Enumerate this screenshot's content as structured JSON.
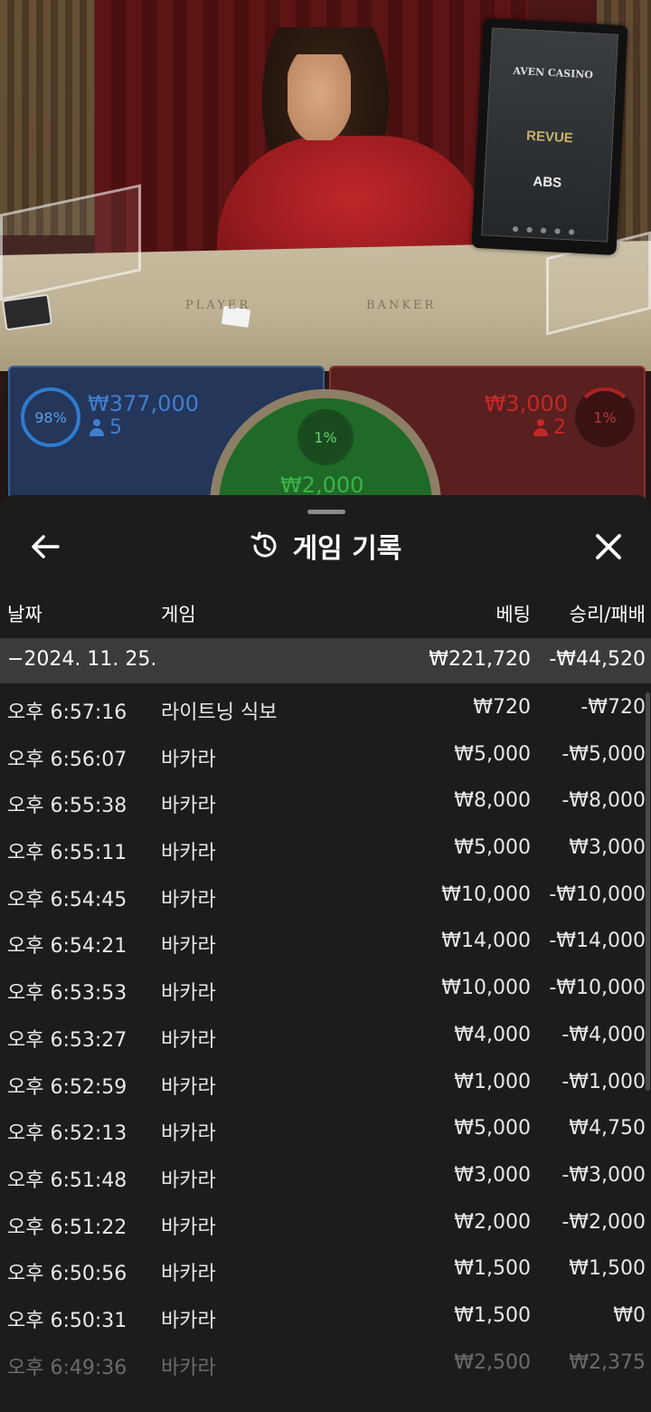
{
  "scene": {
    "table_labels": {
      "player": "PLAYER",
      "banker": "BANKER"
    },
    "monitor_brands": {
      "aven": "AVEN CASINO",
      "revue": "REVUE",
      "abs": "ABS"
    }
  },
  "bets": {
    "player": {
      "percent": "98%",
      "amount": "₩377,000",
      "players": "5",
      "color": "#3f7fd0"
    },
    "tie": {
      "percent": "1%",
      "amount": "₩2,000",
      "color": "#3fb24a"
    },
    "banker": {
      "percent": "1%",
      "amount": "₩3,000",
      "players": "2",
      "color": "#c22828"
    }
  },
  "sheet": {
    "title": "게임 기록",
    "columns": {
      "date": "날짜",
      "game": "게임",
      "bet": "베팅",
      "result": "승리/패배"
    },
    "summary": {
      "date": "−2024. 11. 25.",
      "bet": "₩221,720",
      "result": "-₩44,520"
    },
    "rows": [
      {
        "time": "오후 6:57:16",
        "game": "라이트닝 식보",
        "bet": "₩720",
        "result": "-₩720"
      },
      {
        "time": "오후 6:56:07",
        "game": "바카라",
        "bet": "₩5,000",
        "result": "-₩5,000"
      },
      {
        "time": "오후 6:55:38",
        "game": "바카라",
        "bet": "₩8,000",
        "result": "-₩8,000"
      },
      {
        "time": "오후 6:55:11",
        "game": "바카라",
        "bet": "₩5,000",
        "result": "₩3,000"
      },
      {
        "time": "오후 6:54:45",
        "game": "바카라",
        "bet": "₩10,000",
        "result": "-₩10,000"
      },
      {
        "time": "오후 6:54:21",
        "game": "바카라",
        "bet": "₩14,000",
        "result": "-₩14,000"
      },
      {
        "time": "오후 6:53:53",
        "game": "바카라",
        "bet": "₩10,000",
        "result": "-₩10,000"
      },
      {
        "time": "오후 6:53:27",
        "game": "바카라",
        "bet": "₩4,000",
        "result": "-₩4,000"
      },
      {
        "time": "오후 6:52:59",
        "game": "바카라",
        "bet": "₩1,000",
        "result": "-₩1,000"
      },
      {
        "time": "오후 6:52:13",
        "game": "바카라",
        "bet": "₩5,000",
        "result": "₩4,750"
      },
      {
        "time": "오후 6:51:48",
        "game": "바카라",
        "bet": "₩3,000",
        "result": "-₩3,000"
      },
      {
        "time": "오후 6:51:22",
        "game": "바카라",
        "bet": "₩2,000",
        "result": "-₩2,000"
      },
      {
        "time": "오후 6:50:56",
        "game": "바카라",
        "bet": "₩1,500",
        "result": "₩1,500"
      },
      {
        "time": "오후 6:50:31",
        "game": "바카라",
        "bet": "₩1,500",
        "result": "₩0"
      },
      {
        "time": "오후 6:49:36",
        "game": "바카라",
        "bet": "₩2,500",
        "result": "₩2,375"
      }
    ]
  }
}
